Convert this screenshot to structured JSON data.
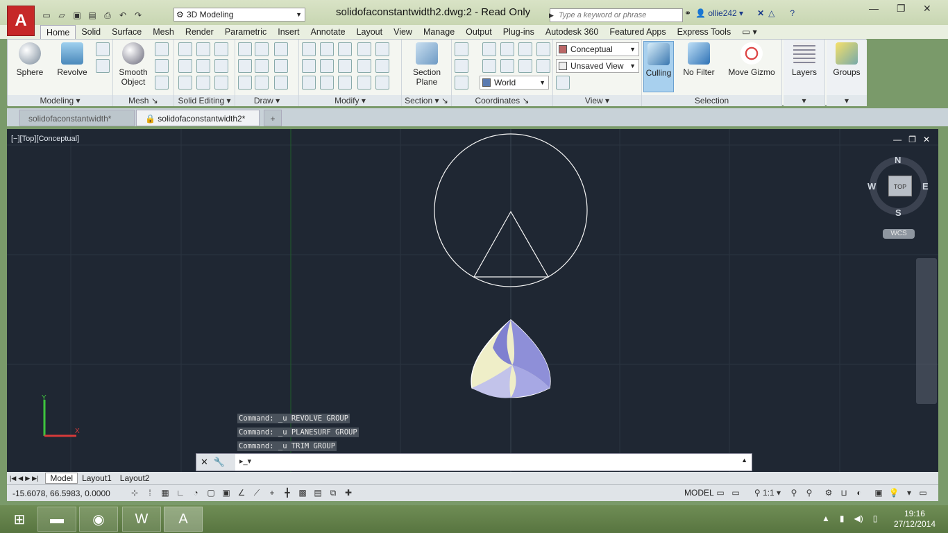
{
  "app": {
    "logo_letter": "A",
    "document_title": "solidofaconstantwidth2.dwg:2 - Read Only"
  },
  "workspace": {
    "selected": "3D Modeling"
  },
  "search": {
    "placeholder": "Type a keyword or phrase"
  },
  "user": {
    "name": "ollie242"
  },
  "tabs": [
    "Home",
    "Solid",
    "Surface",
    "Mesh",
    "Render",
    "Parametric",
    "Insert",
    "Annotate",
    "Layout",
    "View",
    "Manage",
    "Output",
    "Plug-ins",
    "Autodesk 360",
    "Featured Apps",
    "Express Tools"
  ],
  "ribbon": {
    "modeling": {
      "title": "Modeling",
      "sphere": "Sphere",
      "revolve": "Revolve"
    },
    "mesh": {
      "title": "Mesh",
      "smooth": "Smooth Object"
    },
    "solid_editing": {
      "title": "Solid Editing"
    },
    "draw": {
      "title": "Draw"
    },
    "modify": {
      "title": "Modify"
    },
    "section": {
      "title": "Section",
      "section_plane": "Section Plane"
    },
    "coordinates": {
      "title": "Coordinates",
      "world": "World"
    },
    "view": {
      "title": "View",
      "visual_style": "Conceptual",
      "named_view": "Unsaved View"
    },
    "selection": {
      "title": "Selection",
      "culling": "Culling",
      "no_filter": "No Filter",
      "move_gizmo": "Move Gizmo"
    },
    "layers": "Layers",
    "groups": "Groups"
  },
  "file_tabs": [
    "solidofaconstantwidth*",
    "solidofaconstantwidth2*"
  ],
  "viewport": {
    "label": "[−][Top][Conceptual]",
    "compass": {
      "n": "N",
      "s": "S",
      "e": "E",
      "w": "W",
      "top": "TOP"
    },
    "wcs": "WCS"
  },
  "command_history": [
    "Command: _u REVOLVE GROUP",
    "Command: _u PLANESURF GROUP",
    "Command: _u TRIM GROUP"
  ],
  "layout_tabs": [
    "Model",
    "Layout1",
    "Layout2"
  ],
  "status": {
    "coords": "-15.6078, 66.5983, 0.0000",
    "model": "MODEL",
    "scale": "1:1"
  },
  "taskbar": {
    "time": "19:16",
    "date": "27/12/2014"
  }
}
